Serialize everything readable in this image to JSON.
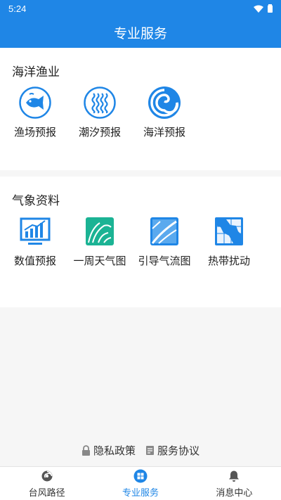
{
  "status_bar": {
    "time": "5:24"
  },
  "app_bar": {
    "title": "专业服务"
  },
  "sections": [
    {
      "title": "海洋渔业",
      "items": [
        {
          "label": "渔场预报",
          "icon": "fish-icon"
        },
        {
          "label": "潮汐预报",
          "icon": "tide-icon"
        },
        {
          "label": "海洋预报",
          "icon": "ocean-wave-icon"
        }
      ]
    },
    {
      "title": "气象资料",
      "items": [
        {
          "label": "数值预报",
          "icon": "bar-chart-icon"
        },
        {
          "label": "一周天气图",
          "icon": "weather-map-icon"
        },
        {
          "label": "引导气流图",
          "icon": "airflow-map-icon"
        },
        {
          "label": "热带扰动",
          "icon": "tropical-disturbance-icon"
        }
      ]
    }
  ],
  "footer": {
    "privacy": "隐私政策",
    "agreement": "服务协议"
  },
  "tabbar": [
    {
      "label": "台风路径",
      "icon": "typhoon-icon",
      "active": false
    },
    {
      "label": "专业服务",
      "icon": "service-grid-icon",
      "active": true
    },
    {
      "label": "消息中心",
      "icon": "bell-icon",
      "active": false
    }
  ],
  "colors": {
    "primary": "#1f86e6",
    "icon_teal": "#1bb394"
  }
}
